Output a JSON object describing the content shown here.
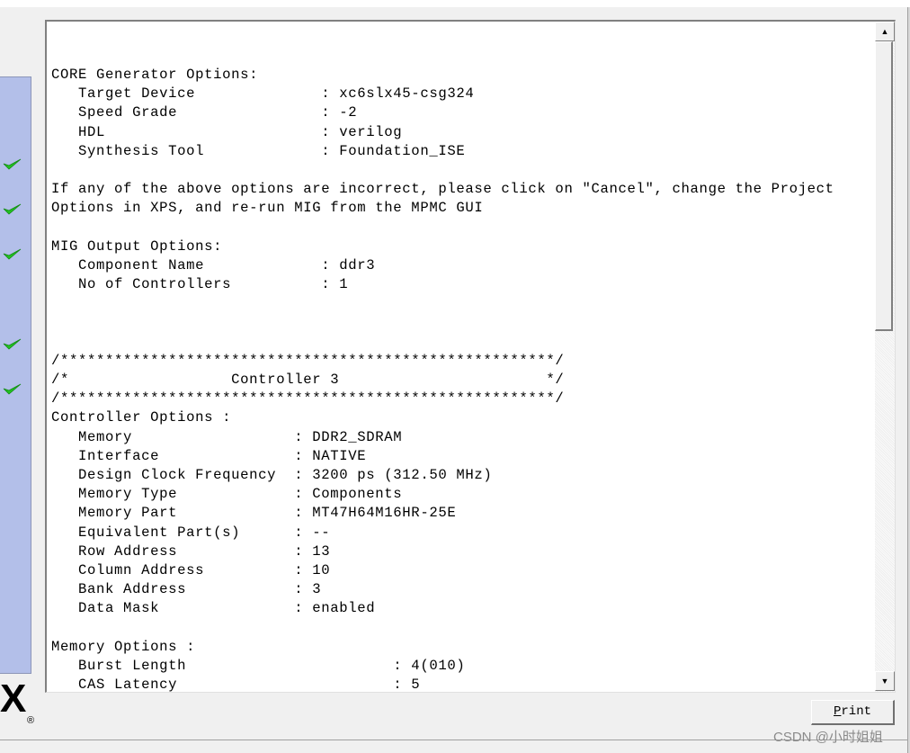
{
  "log_lines": [
    "CORE Generator Options:",
    "   Target Device              : xc6slx45-csg324",
    "   Speed Grade                : -2",
    "   HDL                        : verilog",
    "   Synthesis Tool             : Foundation_ISE",
    "",
    "If any of the above options are incorrect, please click on \"Cancel\", change the Project",
    "Options in XPS, and re-run MIG from the MPMC GUI",
    "",
    "MIG Output Options:",
    "   Component Name             : ddr3",
    "   No of Controllers          : 1",
    "",
    "",
    "",
    "/*******************************************************/",
    "/*                  Controller 3                       */",
    "/*******************************************************/",
    "Controller Options :",
    "   Memory                  : DDR2_SDRAM",
    "   Interface               : NATIVE",
    "   Design Clock Frequency  : 3200 ps (312.50 MHz)",
    "   Memory Type             : Components",
    "   Memory Part             : MT47H64M16HR-25E",
    "   Equivalent Part(s)      : --",
    "   Row Address             : 13",
    "   Column Address          : 10",
    "   Bank Address            : 3",
    "   Data Mask               : enabled",
    "",
    "Memory Options :",
    "   Burst Length                       : 4(010)",
    "   CAS Latency                        : 5"
  ],
  "print_button": {
    "label": "Print",
    "mnemonic": "P",
    "rest": "rint"
  },
  "logo_text": "X",
  "logo_mark": "®",
  "watermark": "CSDN @小时姐姐",
  "icons": {
    "step_status": "check-icon",
    "scroll_up": "arrow-up-icon",
    "scroll_down": "arrow-down-icon"
  },
  "colors": {
    "panel": "#b3bfe9",
    "check": "#22c322"
  }
}
